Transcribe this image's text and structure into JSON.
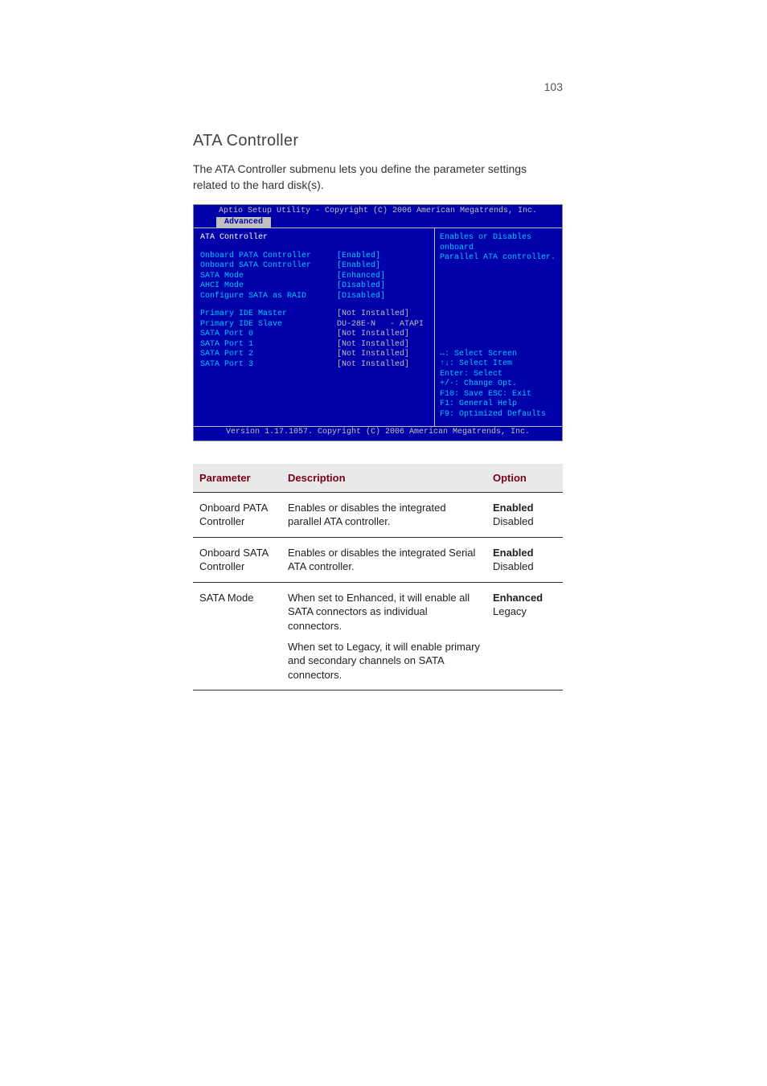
{
  "page": {
    "number": "103",
    "section_title": "ATA Controller",
    "intro": "The ATA Controller submenu lets you define the parameter settings related to the hard disk(s)."
  },
  "bios": {
    "header": "Aptio Setup Utility - Copyright (C) 2006 American Megatrends, Inc.",
    "tab": "Advanced",
    "title": "ATA Controller",
    "rows_top": [
      {
        "label": "Onboard PATA Controller",
        "value": "[Enabled]"
      },
      {
        "label": "Onboard SATA Controller",
        "value": "[Enabled]"
      },
      {
        "label": "SATA Mode",
        "value": "[Enhanced]"
      },
      {
        "label": "AHCI Mode",
        "value": "[Disabled]"
      },
      {
        "label": "Configure SATA as RAID",
        "value": "[Disabled]"
      }
    ],
    "rows_bottom": [
      {
        "label": "Primary IDE Master",
        "value": "[Not Installed]"
      },
      {
        "label": "Primary IDE Slave",
        "value": "DU-28E-N   - ATAPI"
      },
      {
        "label": "SATA Port 0",
        "value": "[Not Installed]"
      },
      {
        "label": "SATA Port 1",
        "value": "[Not Installed]"
      },
      {
        "label": "SATA Port 2",
        "value": "[Not Installed]"
      },
      {
        "label": "SATA Port 3",
        "value": "[Not Installed]"
      }
    ],
    "right_desc_1": "Enables or Disables onboard",
    "right_desc_2": "Parallel ATA controller.",
    "help": {
      "l1": "↔: Select Screen",
      "l2": "↑↓: Select Item",
      "l3": "Enter: Select",
      "l4": "+/-: Change Opt.",
      "l5": "F10: Save  ESC: Exit",
      "l6": "F1: General Help",
      "l7": "F9: Optimized Defaults"
    },
    "footer": "Version 1.17.1057. Copyright (C) 2006 American Megatrends, Inc."
  },
  "table": {
    "headers": {
      "param": "Parameter",
      "desc": "Description",
      "opt": "Option"
    },
    "rows": [
      {
        "param": "Onboard PATA Controller",
        "desc": "Enables or disables the integrated parallel ATA controller.",
        "opt_bold": "Enabled",
        "opt_plain": "Disabled"
      },
      {
        "param": "Onboard SATA Controller",
        "desc": "Enables or disables the integrated Serial ATA controller.",
        "opt_bold": "Enabled",
        "opt_plain": "Disabled"
      },
      {
        "param": "SATA Mode",
        "desc": "When set to Enhanced, it will enable all SATA connectors as individual connectors.",
        "desc2": "When set to Legacy, it will enable primary and secondary channels on SATA connectors.",
        "opt_bold": "Enhanced",
        "opt_plain": "Legacy"
      }
    ]
  }
}
